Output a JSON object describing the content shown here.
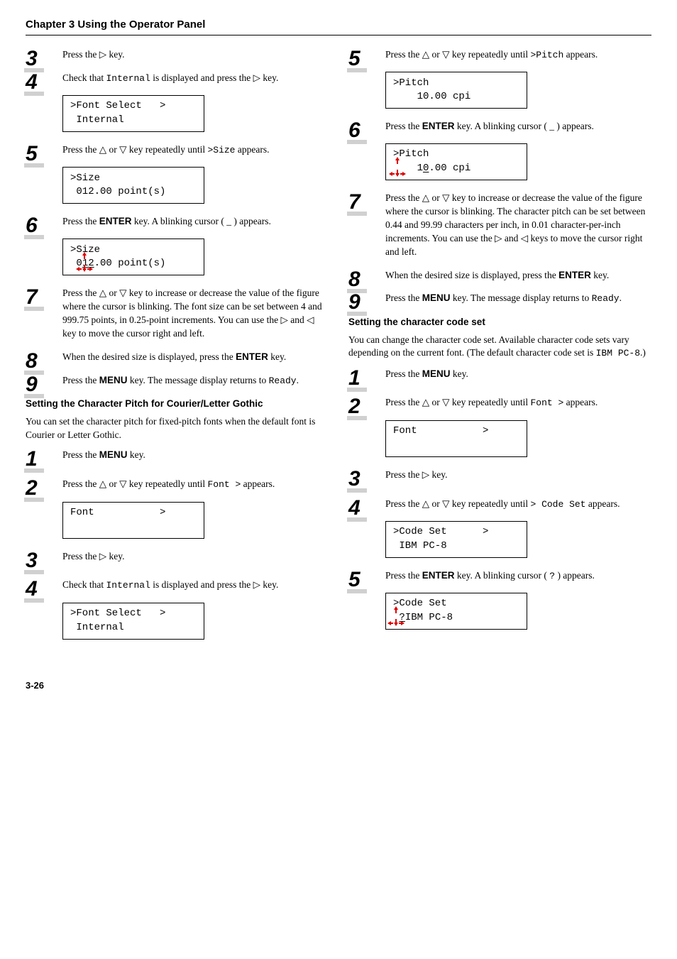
{
  "chapter": "Chapter 3  Using the Operator Panel",
  "page": "3-26",
  "triangles": {
    "right": "▷",
    "up": "△",
    "down": "▽",
    "left": "◁"
  },
  "left": {
    "s3": "Press the ▷ key.",
    "s4a": "Check that ",
    "s4b": "Internal",
    "s4c": " is displayed and press the ▷ key.",
    "lcd4_l1": ">Font Select   >",
    "lcd4_l2": " Internal",
    "s5a": "Press the △ or ▽ key repeatedly until ",
    "s5b": ">Size",
    "s5c": " appears.",
    "lcd5_l1": ">Size",
    "lcd5_l2": " 012.00 point(s)",
    "s6a": "Press the ",
    "s6b": "ENTER",
    "s6c": " key. A blinking cursor ( _ ) appears.",
    "lcd6_l1": ">Size",
    "lcd6_l2_a": " 0",
    "lcd6_l2_b": "12",
    "lcd6_l2_c": ".00 point(s)",
    "s7": "Press the △ or ▽ key to increase or decrease the value of the figure where the cursor is blinking. The font size can be set between 4 and 999.75 points, in 0.25-point increments. You can use the ▷ and ◁ key to move the cursor right and left.",
    "s8a": "When the desired size is displayed, press the ",
    "s8b": "ENTER",
    "s8c": " key.",
    "s9a": "Press the ",
    "s9b": "MENU",
    "s9c": " key. The message display returns to ",
    "s9d": "Ready",
    "s9e": ".",
    "secA_title": "Setting the Character Pitch for Courier/Letter Gothic",
    "secA_intro": "You can set the character pitch for fixed-pitch fonts when the default font is Courier or Letter Gothic.",
    "a1a": "Press the ",
    "a1b": "MENU",
    "a1c": " key.",
    "a2a": "Press the △ or ▽ key repeatedly until ",
    "a2b": "Font  >",
    "a2c": " appears.",
    "lcdA2_l1": "Font           >",
    "a3": "Press the ▷ key.",
    "a4a": "Check that ",
    "a4b": "Internal",
    "a4c": " is displayed and press the ▷ key.",
    "lcdA4_l1": ">Font Select   >",
    "lcdA4_l2": " Internal"
  },
  "right": {
    "s5a": "Press the △ or ▽ key repeatedly until ",
    "s5b": ">Pitch",
    "s5c": " appears.",
    "lcd5_l1": ">Pitch",
    "lcd5_l2": "    10.00 cpi",
    "s6a": "Press the ",
    "s6b": "ENTER",
    "s6c": " key. A blinking cursor ( _ ) appears.",
    "lcd6_l1": ">Pitch",
    "lcd6_l2_a": "    1",
    "lcd6_l2_b": "0",
    "lcd6_l2_c": ".00 cpi",
    "s7": "Press the △ or ▽ key to increase or decrease the value of the figure where the cursor is blinking. The character pitch can be set between 0.44 and 99.99 characters per inch, in 0.01 character-per-inch increments. You can use the ▷ and ◁ keys to move the cursor right and left.",
    "s8a": "When the desired size is displayed, press the ",
    "s8b": "ENTER",
    "s8c": " key.",
    "s9a": "Press the ",
    "s9b": "MENU",
    "s9c": " key. The message display returns to ",
    "s9d": "Ready",
    "s9e": ".",
    "secB_title": "Setting the character code set",
    "secB_intro_a": "You can change the character code set. Available character code sets vary depending on the current font. (The default character code set is ",
    "secB_intro_b": "IBM PC-8",
    "secB_intro_c": ".)",
    "b1a": "Press the ",
    "b1b": "MENU",
    "b1c": " key.",
    "b2a": "Press the △ or ▽ key repeatedly until ",
    "b2b": "Font  >",
    "b2c": " appears.",
    "lcdB2_l1": "Font           >",
    "b3": "Press the ▷ key.",
    "b4a": "Press the △ or ▽ key repeatedly until ",
    "b4b": " > Code Set",
    "b4c": " appears.",
    "lcdB4_l1": ">Code Set      >",
    "lcdB4_l2": " IBM PC-8",
    "b5a": "Press the ",
    "b5b": "ENTER",
    "b5c": " key. A blinking cursor ( ",
    "b5d": "?",
    "b5e": " ) appears.",
    "lcdB5_l1": ">Code Set",
    "lcdB5_l2_a": "?",
    "lcdB5_l2_b": "IBM PC-8"
  }
}
